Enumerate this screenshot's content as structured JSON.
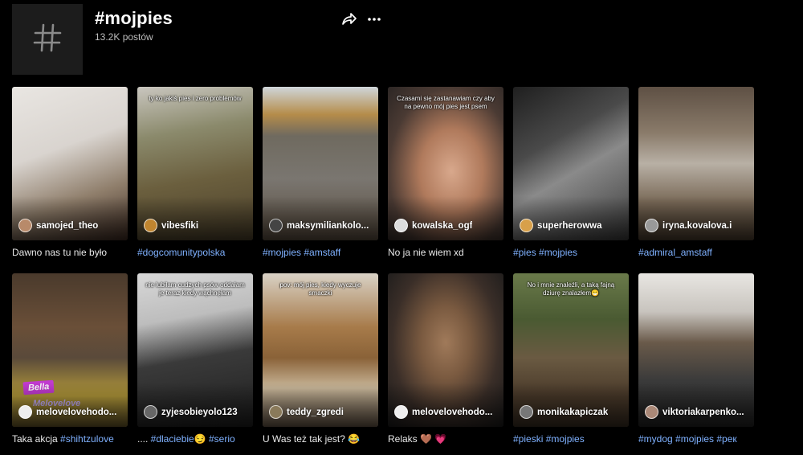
{
  "header": {
    "title": "#mojpies",
    "subtitle": "13.2K postów",
    "avatar_icon": "hashtag-icon",
    "share_icon": "share-icon",
    "more_icon": "more-icon"
  },
  "videos": [
    {
      "username": "samojed_theo",
      "overlay": "",
      "caption_text": "Dawno nas tu nie było",
      "caption_tags": "",
      "bg": "linear-gradient(160deg,#e9e6e2 0%,#d9d4cf 40%,#8f7e6b 70%,#3e2b22 100%)",
      "avatar_color": "#b88a6a"
    },
    {
      "username": "vibesfiki",
      "overlay": "ty ko jakiś pies i zero problemów",
      "caption_text": "",
      "caption_tags": "#dogcomunitypolska",
      "bg": "linear-gradient(170deg,#c9c6bf 0%,#8b8a6c 30%,#6b5f3e 60%,#4a3f2a 100%)",
      "avatar_color": "#c0852f"
    },
    {
      "username": "maksymiliankolo...",
      "overlay": "",
      "caption_text": "",
      "caption_tags": "#mojpies #amstaff",
      "bg": "linear-gradient(180deg,#cfd6da 0%,#b58c4a 18%,#6f6a5f 32%,#7a7670 60%,#5a4d3f 100%)",
      "avatar_color": "#444"
    },
    {
      "username": "kowalska_ogf",
      "overlay": "Czasami się zastanawiam czy aby na pewno mój pies jest psem",
      "caption_text": "No ja nie wiem xd",
      "caption_tags": "",
      "bg": "radial-gradient(ellipse at 55% 55%,#d8a88c 0%,#b07a5c 35%,#4a3a33 70%,#2c2624 100%)",
      "avatar_color": "#ddd"
    },
    {
      "username": "superherowwa",
      "overlay": "",
      "caption_text": "",
      "caption_tags": "#pies #mojpies",
      "bg": "linear-gradient(150deg,#1f1f1f 0%,#4a4a4a 35%,#8a8a8a 55%,#3a3a3a 100%)",
      "avatar_color": "#d8a04a"
    },
    {
      "username": "iryna.kovalova.i",
      "overlay": "",
      "caption_text": "",
      "caption_tags": "#admiral_amstaff",
      "bg": "linear-gradient(180deg,#5e5044 0%,#8a7b6a 30%,#b8b0a5 50%,#7a6a58 75%,#4a3c2e 100%)",
      "avatar_color": "#999"
    },
    {
      "username": "melovelovehodo...",
      "overlay": "",
      "caption_text": "Taka akcja ",
      "caption_tags": "#shihtzulove",
      "bg": "linear-gradient(180deg,#4a3a2c 0%,#6a4f38 35%,#5a4a3a 55%,#b49a3a 80%,#6a5a2a 100%)",
      "avatar_color": "#eee",
      "badge": "Bella",
      "subbadge": "Melovelove"
    },
    {
      "username": "zyjesobieyolo123",
      "overlay": "nie lubiłam cudzych psów oddałam je teraz kiedy wąchnęłam",
      "caption_text": ".... ",
      "caption_tags": "#dlaciebie😏 #serio",
      "bg": "linear-gradient(170deg,#d8d8d8 0%,#bdbdbd 30%,#3a3a3a 55%,#1e1e1e 100%)",
      "avatar_color": "#666"
    },
    {
      "username": "teddy_zgredi",
      "overlay": "pov: mój pies, kiedy wyczuje smaczki",
      "caption_text": "U Was też tak jest? 😂",
      "caption_tags": "",
      "bg": "linear-gradient(180deg,#d9d2c6 0%,#a77b4a 35%,#8a6238 55%,#c9b79a 75%,#6a5a4a 100%)",
      "avatar_color": "#8a7a5a"
    },
    {
      "username": "melovelovehodo...",
      "overlay": "",
      "caption_text": "Relaks 🤎 💗",
      "caption_tags": "",
      "bg": "radial-gradient(ellipse at 50% 45%,#a07a5a 0%,#7a5a40 30%,#3a2e28 65%,#1a1a1a 100%)",
      "avatar_color": "#eee"
    },
    {
      "username": "monikakapiczak",
      "overlay": "No i mnie znaleźli, a taką fajną dziurę znalazłem😁",
      "caption_text": "",
      "caption_tags": "#pieski #mojpies",
      "bg": "linear-gradient(180deg,#6a7a4a 0%,#4a5a32 30%,#6a5a42 55%,#4a3a2a 80%,#3a2e22 100%)",
      "avatar_color": "#777"
    },
    {
      "username": "viktoriakarpenko...",
      "overlay": "",
      "caption_text": "",
      "caption_tags": "#mydog #mojpies #рек",
      "bg": "linear-gradient(180deg,#e8e6e2 0%,#c8c4be 25%,#6a5a4a 45%,#3a3a3a 70%,#222 100%)",
      "avatar_color": "#aa8877"
    }
  ]
}
